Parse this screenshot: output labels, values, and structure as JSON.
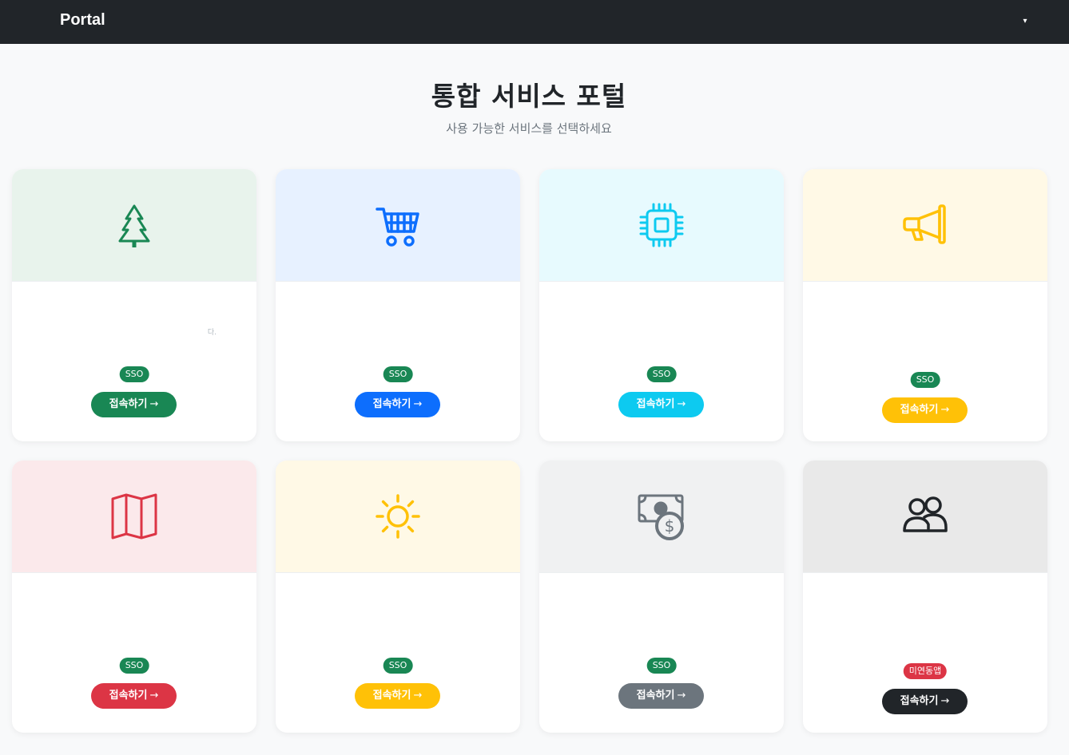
{
  "navbar": {
    "brand": "Portal",
    "dropdown_glyph": "▾"
  },
  "hero": {
    "title": "통합 서비스 포털",
    "subtitle": "사용 가능한 서비스를 선택하세요"
  },
  "cards": [
    {
      "icon": "tree-icon",
      "badge": "SSO",
      "button": "접속하기",
      "arrow": "→",
      "desc": "다.",
      "accent": "#198754",
      "bg": "#e8f3ec",
      "badge_color": "#198754"
    },
    {
      "icon": "cart-icon",
      "badge": "SSO",
      "button": "접속하기",
      "arrow": "→",
      "desc": "",
      "accent": "#0d6efd",
      "bg": "#e7f1ff",
      "badge_color": "#198754"
    },
    {
      "icon": "cpu-icon",
      "badge": "SSO",
      "button": "접속하기",
      "arrow": "→",
      "desc": "",
      "accent": "#0dcaf0",
      "bg": "#e7fafe",
      "badge_color": "#198754"
    },
    {
      "icon": "megaphone-icon",
      "badge": "SSO",
      "button": "접속하기",
      "arrow": "→",
      "desc": "",
      "accent": "#ffc107",
      "bg": "#fff9e6",
      "badge_color": "#198754"
    },
    {
      "icon": "map-icon",
      "badge": "SSO",
      "button": "접속하기",
      "arrow": "→",
      "desc": "",
      "accent": "#dc3545",
      "bg": "#fbe9eb",
      "badge_color": "#198754"
    },
    {
      "icon": "sun-icon",
      "badge": "SSO",
      "button": "접속하기",
      "arrow": "→",
      "desc": "",
      "accent": "#ffc107",
      "bg": "#fff9e6",
      "badge_color": "#198754"
    },
    {
      "icon": "cash-coin-icon",
      "badge": "SSO",
      "button": "접속하기",
      "arrow": "→",
      "desc": "",
      "accent": "#6c757d",
      "bg": "#f0f1f2",
      "badge_color": "#198754"
    },
    {
      "icon": "people-icon",
      "badge": "미연동앱",
      "button": "접속하기",
      "arrow": "→",
      "desc": "",
      "accent": "#212529",
      "bg": "#e9e9e9",
      "badge_color": "#dc3545"
    }
  ]
}
